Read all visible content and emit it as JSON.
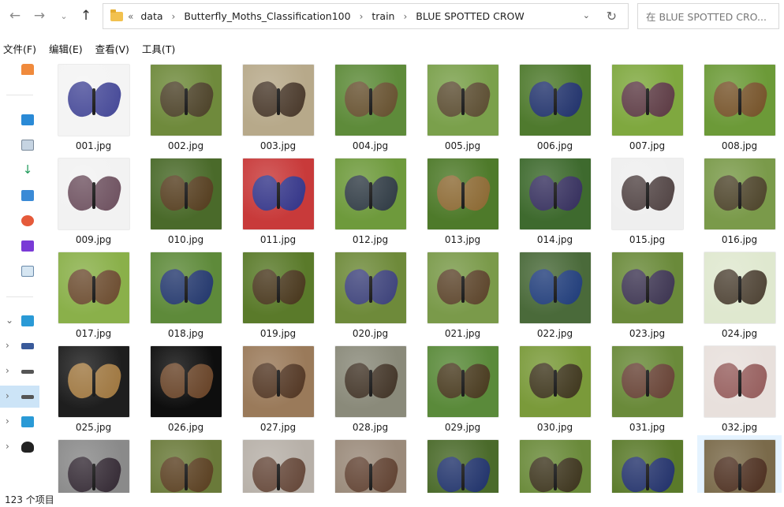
{
  "window": {
    "breadcrumb": [
      "data",
      "Butterfly_Moths_Classification100",
      "train",
      "BLUE SPOTTED CROW"
    ],
    "breadcrumb_more": "«",
    "search_placeholder": "在 BLUE SPOTTED CRO..."
  },
  "menu": [
    "文件(F)",
    "编辑(E)",
    "查看(V)",
    "工具(T)"
  ],
  "icons": {
    "back": "arrow-left-icon",
    "forward": "arrow-right-icon",
    "history": "chevron-down-icon",
    "up": "arrow-up-icon",
    "refresh": "refresh-icon",
    "dropdown": "chevron-down-icon",
    "folder": "folder-icon"
  },
  "files": [
    {
      "name": "001.jpg",
      "bg": "#f4f4f4",
      "wing": "#2b2f8a"
    },
    {
      "name": "002.jpg",
      "bg": "#6f8a3c",
      "wing": "#4b3a2a"
    },
    {
      "name": "003.jpg",
      "bg": "#b7a98a",
      "wing": "#3b2a1e"
    },
    {
      "name": "004.jpg",
      "bg": "#5e8b3a",
      "wing": "#6b4a33"
    },
    {
      "name": "005.jpg",
      "bg": "#7aa04b",
      "wing": "#5a4332"
    },
    {
      "name": "006.jpg",
      "bg": "#4f7a2e",
      "wing": "#1f2b7a"
    },
    {
      "name": "007.jpg",
      "bg": "#7fa83f",
      "wing": "#5a2d4a"
    },
    {
      "name": "008.jpg",
      "bg": "#6c9a38",
      "wing": "#7a4a2c"
    },
    {
      "name": "009.jpg",
      "bg": "#f2f2f2",
      "wing": "#5a3a4a"
    },
    {
      "name": "010.jpg",
      "bg": "#4a6a2a",
      "wing": "#5a3a22"
    },
    {
      "name": "011.jpg",
      "bg": "#c83a3a",
      "wing": "#1e3a9a"
    },
    {
      "name": "012.jpg",
      "bg": "#6e9a3c",
      "wing": "#2a2f4a"
    },
    {
      "name": "013.jpg",
      "bg": "#4e7a2a",
      "wing": "#9a6a3a"
    },
    {
      "name": "014.jpg",
      "bg": "#3e6a2e",
      "wing": "#3a2a6a"
    },
    {
      "name": "015.jpg",
      "bg": "#efefef",
      "wing": "#3a2a2a"
    },
    {
      "name": "016.jpg",
      "bg": "#7a9a4a",
      "wing": "#4a3a2a"
    },
    {
      "name": "017.jpg",
      "bg": "#8ab04a",
      "wing": "#6a4030"
    },
    {
      "name": "018.jpg",
      "bg": "#5e8a3a",
      "wing": "#1e2e7a"
    },
    {
      "name": "019.jpg",
      "bg": "#5a7a2a",
      "wing": "#4a3020"
    },
    {
      "name": "020.jpg",
      "bg": "#6e8a3a",
      "wing": "#3a3a8a"
    },
    {
      "name": "021.jpg",
      "bg": "#7a9a4a",
      "wing": "#5a3a2a"
    },
    {
      "name": "022.jpg",
      "bg": "#4a6a3a",
      "wing": "#1e3a8a"
    },
    {
      "name": "023.jpg",
      "bg": "#6a8a3a",
      "wing": "#3a2a5a"
    },
    {
      "name": "024.jpg",
      "bg": "#dfe8cf",
      "wing": "#3a2a1e"
    },
    {
      "name": "025.jpg",
      "bg": "#1e1e1e",
      "wing": "#b78a4a"
    },
    {
      "name": "026.jpg",
      "bg": "#0e0e0e",
      "wing": "#7a5030"
    },
    {
      "name": "027.jpg",
      "bg": "#9a7a5a",
      "wing": "#4a3020"
    },
    {
      "name": "028.jpg",
      "bg": "#8a8a7a",
      "wing": "#3a2a1e"
    },
    {
      "name": "029.jpg",
      "bg": "#5a8a3a",
      "wing": "#4a3020"
    },
    {
      "name": "030.jpg",
      "bg": "#7a9a3a",
      "wing": "#3a2a1e"
    },
    {
      "name": "031.jpg",
      "bg": "#6a8a3a",
      "wing": "#6a3a3a"
    },
    {
      "name": "032.jpg",
      "bg": "#e8e0dc",
      "wing": "#8a4a4a"
    },
    {
      "name": "",
      "bg": "#8a8a8a",
      "wing": "#2a1e2a"
    },
    {
      "name": "",
      "bg": "#6a7a3a",
      "wing": "#5a3a22"
    },
    {
      "name": "",
      "bg": "#b7b0a8",
      "wing": "#5a3a2a"
    },
    {
      "name": "",
      "bg": "#9a8a7a",
      "wing": "#5a3a2a"
    },
    {
      "name": "",
      "bg": "#4a6a2a",
      "wing": "#1e2e7a"
    },
    {
      "name": "",
      "bg": "#6a8a3a",
      "wing": "#3a2a1e"
    },
    {
      "name": "",
      "bg": "#5a7a2a",
      "wing": "#1e2a7a"
    },
    {
      "name": "",
      "bg": "#7a6a4a",
      "wing": "#4a2a1e"
    }
  ],
  "status": {
    "item_count": "123 个项目"
  }
}
